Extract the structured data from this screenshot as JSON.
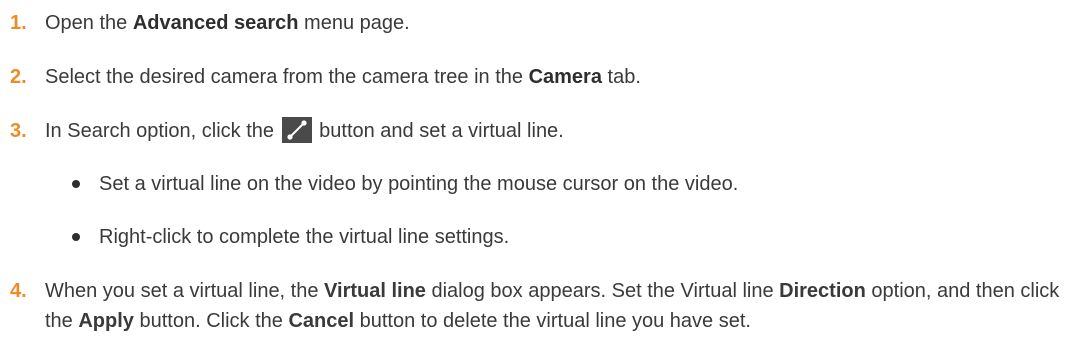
{
  "steps": [
    {
      "number": "1.",
      "parts": [
        "Open the ",
        "Advanced search",
        " menu page."
      ]
    },
    {
      "number": "2.",
      "parts": [
        "Select the desired camera from the camera tree in the ",
        "Camera",
        " tab."
      ]
    },
    {
      "number": "3.",
      "before_icon": "In Search option, click the",
      "icon": "virtual-line-icon",
      "after_icon": "button and set a virtual line.",
      "bullets": [
        "Set a virtual line on the video by pointing the mouse cursor on the video.",
        "Right-click to complete the virtual line settings."
      ]
    },
    {
      "number": "4.",
      "parts": [
        "When you set a virtual line, the ",
        "Virtual line",
        " dialog box appears. Set the Virtual line ",
        "Direction",
        " option, and then click the ",
        "Apply",
        " button. Click the ",
        "Cancel",
        " button to delete the virtual line you have set."
      ]
    }
  ],
  "colors": {
    "step_number": "#f08a24",
    "text": "#3a3a3a",
    "icon_background": "#4a4a4a"
  }
}
